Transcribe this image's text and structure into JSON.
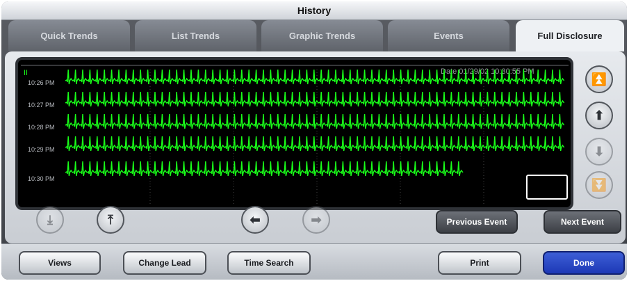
{
  "window": {
    "title": "History"
  },
  "tabs": [
    {
      "label": "Quick Trends"
    },
    {
      "label": "List Trends"
    },
    {
      "label": "Graphic Trends"
    },
    {
      "label": "Events"
    },
    {
      "label": "Full Disclosure",
      "active": true
    }
  ],
  "screen": {
    "lead": "II",
    "datetime": "Date 01/29/02  10:30:55 PM",
    "time_labels": [
      "10:26 PM",
      "10:27 PM",
      "10:28 PM",
      "10:29 PM",
      "10:30 PM"
    ],
    "trace_color": "#19ff19"
  },
  "scroll_buttons": {
    "page_up": "double-up-arrow-icon",
    "line_up": "up-arrow-icon",
    "line_down": "down-arrow-icon",
    "page_down": "double-down-arrow-icon"
  },
  "nav_buttons": {
    "previous_event": "Previous Event",
    "next_event": "Next Event"
  },
  "bottom": {
    "views": "Views",
    "change_lead": "Change Lead",
    "time_search": "Time Search",
    "print": "Print",
    "done": "Done"
  },
  "colors": {
    "done_blue": "#2343c4",
    "window_grey": "#4a4d53"
  }
}
